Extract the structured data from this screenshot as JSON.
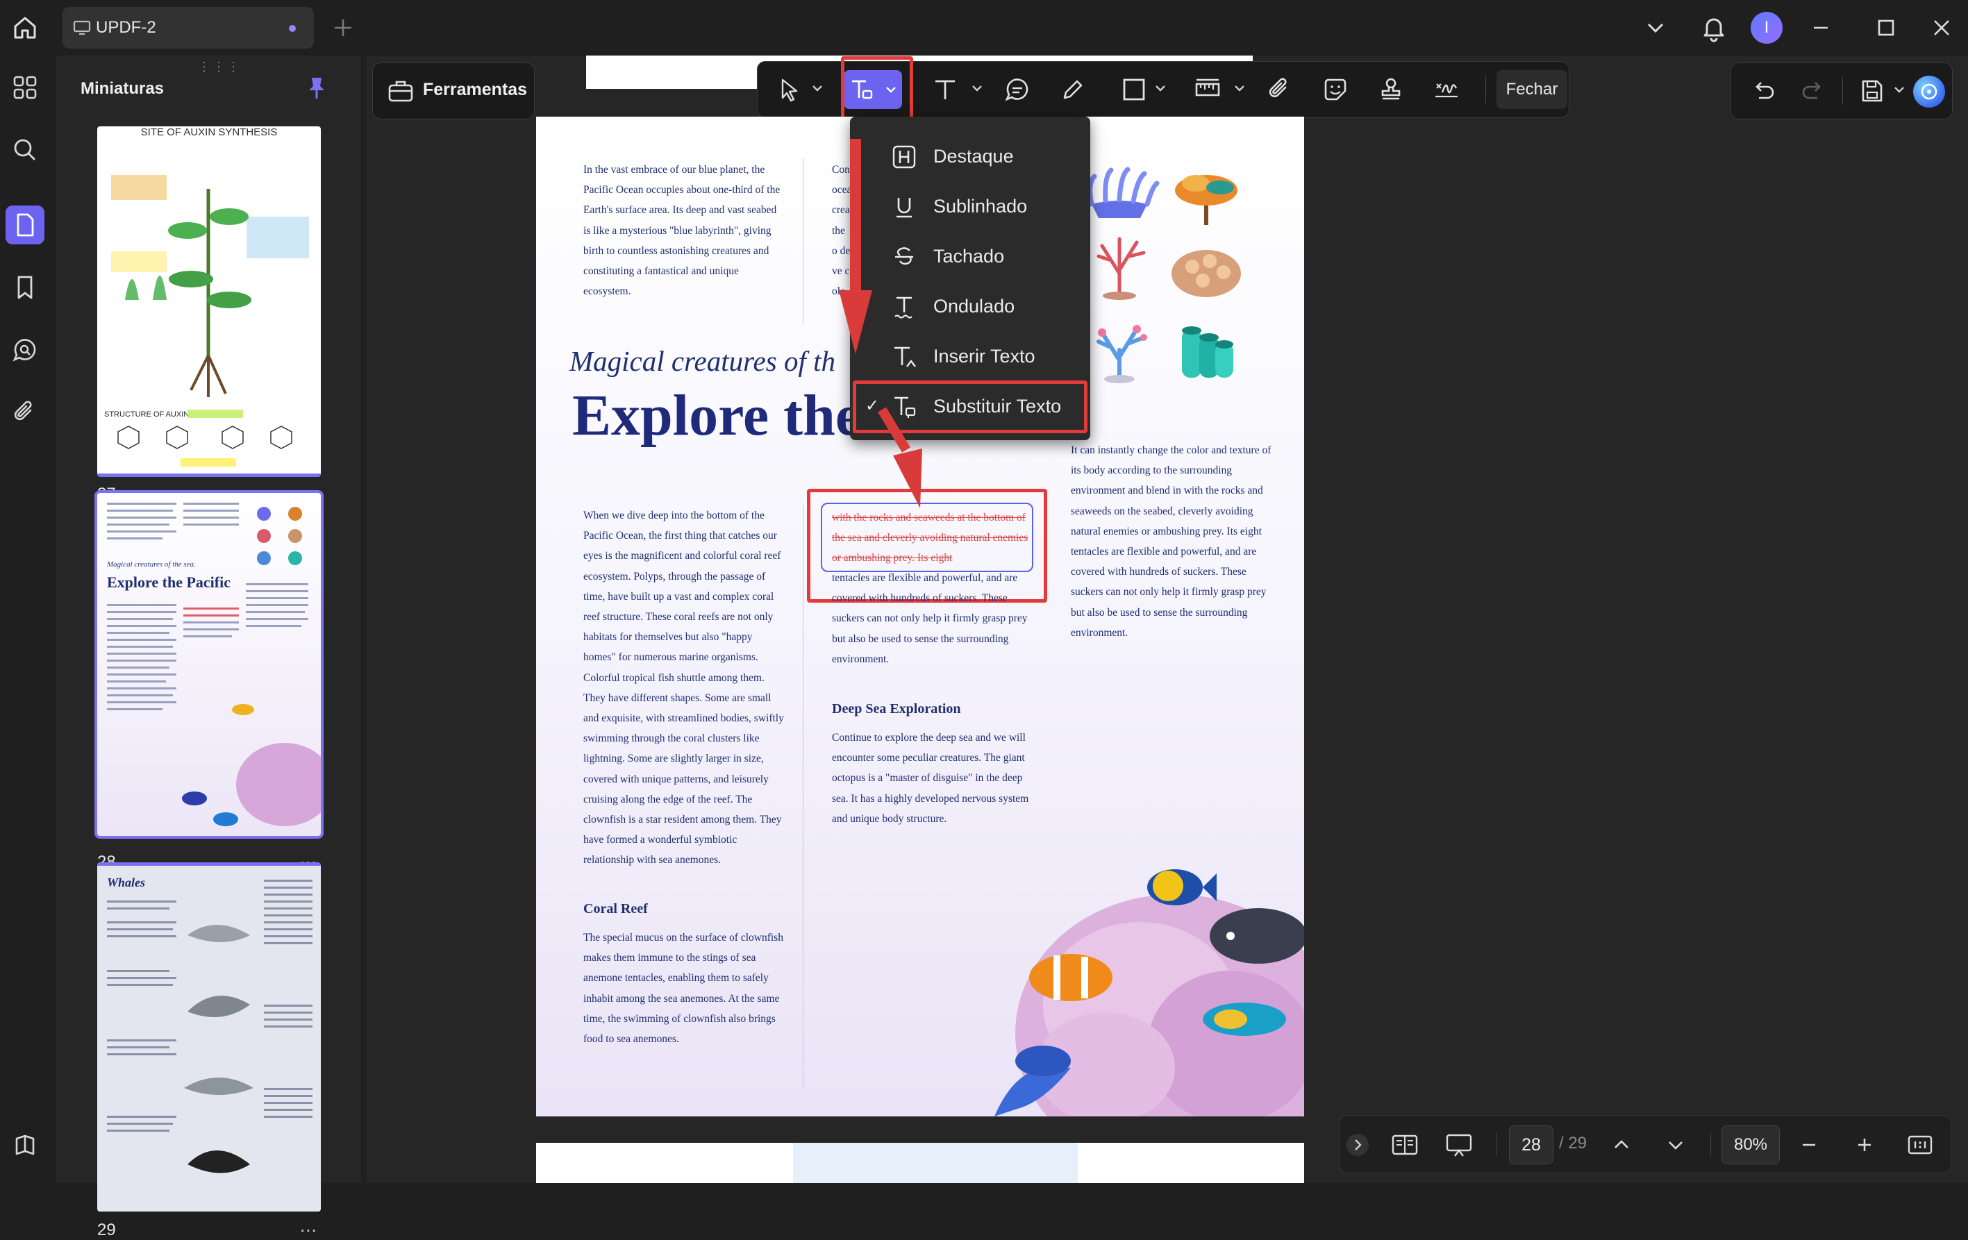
{
  "app": {
    "tab_title": "UPDF-2",
    "user_initial": "I",
    "accent": "#7b72f2"
  },
  "sidebar": {
    "title": "Miniaturas",
    "pages": [
      {
        "number": "27",
        "thumb_title": "SITE OF AUXIN SYNTHESIS"
      },
      {
        "number": "28",
        "thumb_title": "Explore the Pacific"
      },
      {
        "number": "29",
        "thumb_title": "Whales"
      }
    ],
    "more": "..."
  },
  "toolbar": {
    "tools_label": "Ferramentas",
    "close_label": "Fechar"
  },
  "dropdown": {
    "items": [
      {
        "label": "Destaque",
        "icon": "highlight-icon",
        "checked": false
      },
      {
        "label": "Sublinhado",
        "icon": "underline-icon",
        "checked": false
      },
      {
        "label": "Tachado",
        "icon": "strikethrough-icon",
        "checked": false
      },
      {
        "label": "Ondulado",
        "icon": "squiggly-icon",
        "checked": false
      },
      {
        "label": "Inserir Texto",
        "icon": "insert-text-icon",
        "checked": false
      },
      {
        "label": "Substituir Texto",
        "icon": "replace-text-icon",
        "checked": true
      }
    ],
    "check": "✓"
  },
  "document": {
    "col1_top": "In the vast embrace of our blue planet, the Pacific Ocean occupies about one-third of the Earth's surface area. Its deep and vast seabed is like a mysterious \"blue labyrinth\", giving birth to countless astonishing creatures and constituting a fantastical and unique ecosystem.",
    "col2_top": "Con ocea crea the o deve colo",
    "subtitle": "Magical creatures of th",
    "title": "Explore the Pacific",
    "col1_body": "When we dive deep into the bottom of the Pacific Ocean, the first thing that catches our eyes is the magnificent and colorful coral reef ecosystem. Polyps, through the passage of time, have built up a vast and complex coral reef structure. These coral reefs are not only habitats for themselves but also \"happy homes\" for numerous marine organisms. Colorful tropical fish shuttle among them. They have different shapes. Some are small and exquisite, with streamlined bodies, swiftly swimming through the coral clusters like lightning. Some are slightly larger in size, covered with unique patterns, and leisurely cruising along the edge of the reef. The clownfish is a star resident among them. They have formed a wonderful symbiotic relationship with sea anemones.",
    "coral_heading": "Coral Reef",
    "coral_body": "The special mucus on the surface of clownfish makes them immune to the stings of sea anemone tentacles, enabling them to safely inhabit among the sea anemones. At the same time, the swimming of clownfish also brings food to sea anemones.",
    "strike_text": "with the rocks and seaweeds at the bottom of the sea and cleverly avoiding natural enemies or ambushing prey. Its eight",
    "col2_body": "tentacles are flexible and powerful, and are covered with hundreds of suckers. These suckers can not only help it firmly grasp prey but also be used to sense the surrounding environment.",
    "deep_heading": "Deep Sea Exploration",
    "deep_body": "Continue to explore the deep sea and we will encounter some peculiar creatures. The giant octopus is a \"master of disguise\" in the deep sea. It has a highly developed nervous system and unique body structure.",
    "col3_body": "It can instantly change the color and texture of its body according to the surrounding environment and blend in with the rocks and seaweeds on the seabed, cleverly avoiding natural enemies or ambushing prey. Its eight tentacles are flexible and powerful, and are covered with hundreds of suckers. These suckers can not only help it firmly grasp prey but also be used to sense the surrounding environment."
  },
  "bottombar": {
    "page_input": "28",
    "page_total": "/ 29",
    "zoom": "80%"
  }
}
